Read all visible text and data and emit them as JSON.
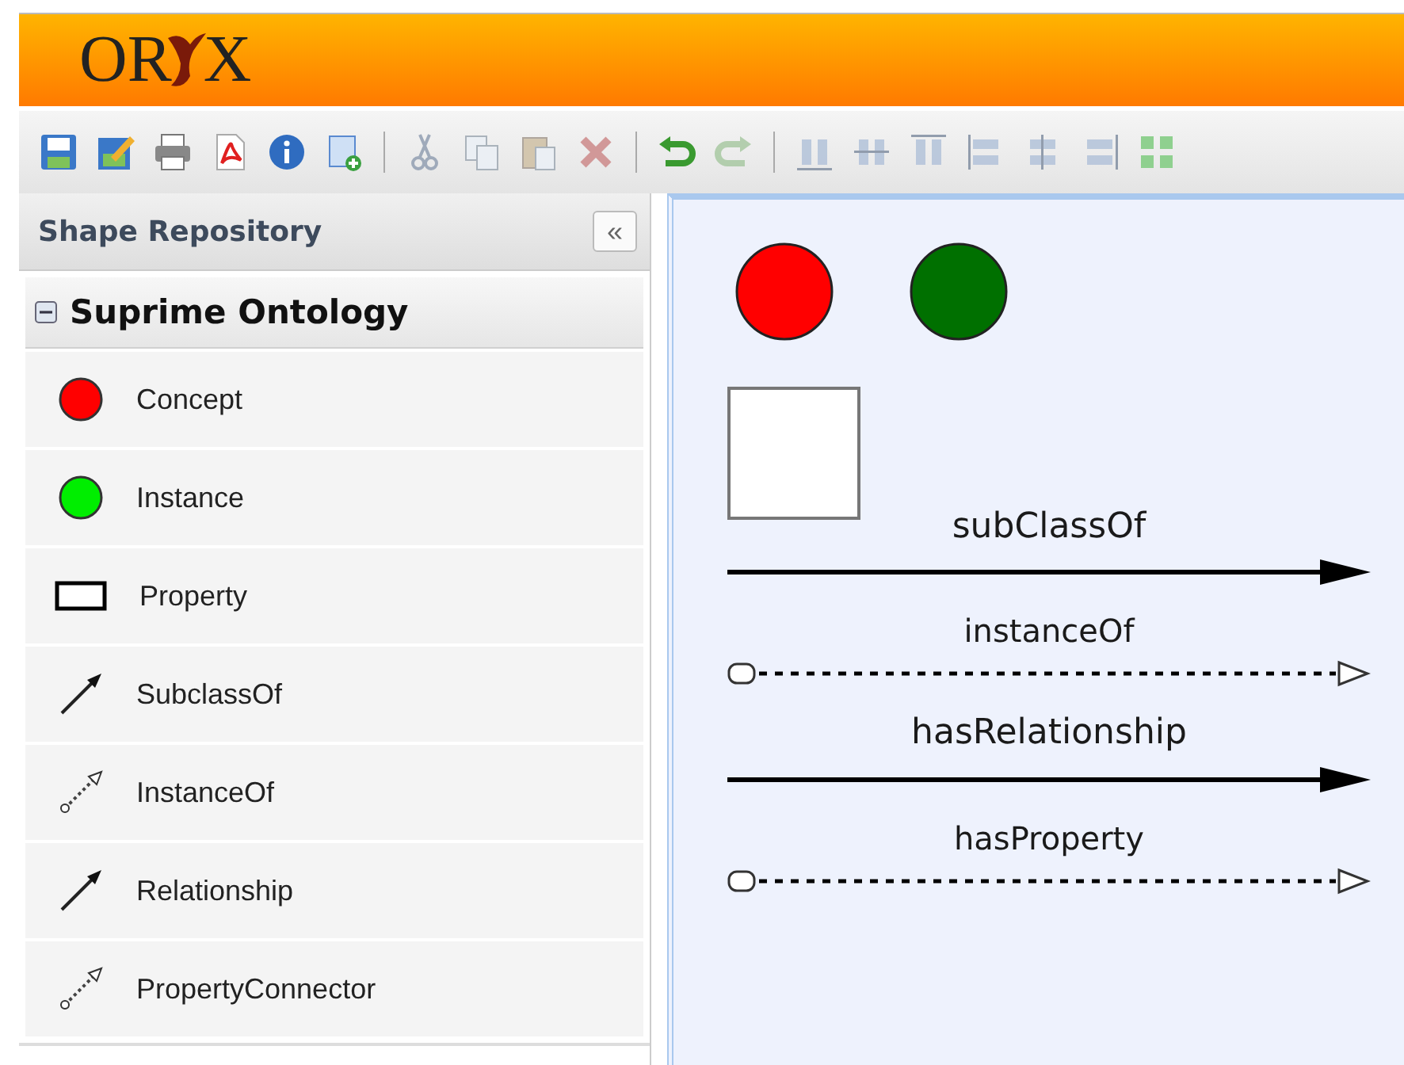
{
  "header": {
    "logo_left": "OR",
    "logo_right": "X"
  },
  "toolbar": [
    {
      "kind": "save",
      "disabled": false
    },
    {
      "kind": "edit",
      "disabled": false
    },
    {
      "kind": "print",
      "disabled": false
    },
    {
      "kind": "pdf",
      "disabled": false
    },
    {
      "kind": "info",
      "disabled": false
    },
    {
      "kind": "new",
      "disabled": false
    },
    {
      "kind": "sep"
    },
    {
      "kind": "cut",
      "disabled": true
    },
    {
      "kind": "copy",
      "disabled": true
    },
    {
      "kind": "paste",
      "disabled": true
    },
    {
      "kind": "delete",
      "disabled": true
    },
    {
      "kind": "sep"
    },
    {
      "kind": "undo",
      "disabled": false
    },
    {
      "kind": "redo",
      "disabled": true
    },
    {
      "kind": "sep"
    },
    {
      "kind": "align-bottom",
      "disabled": true
    },
    {
      "kind": "align-middle",
      "disabled": true
    },
    {
      "kind": "align-top",
      "disabled": true
    },
    {
      "kind": "align-left",
      "disabled": true
    },
    {
      "kind": "align-center",
      "disabled": true
    },
    {
      "kind": "align-right",
      "disabled": true
    },
    {
      "kind": "group",
      "disabled": false
    }
  ],
  "sidebar": {
    "title": "Shape Repository",
    "collapse_button": "«",
    "group": {
      "label": "Suprime Ontology",
      "expanded": true,
      "items": [
        {
          "label": "Concept",
          "kind": "circle",
          "color": "#ff0000"
        },
        {
          "label": "Instance",
          "kind": "circle",
          "color": "#00ee00"
        },
        {
          "label": "Property",
          "kind": "rect"
        },
        {
          "label": "SubclassOf",
          "kind": "arrow"
        },
        {
          "label": "InstanceOf",
          "kind": "dotted"
        },
        {
          "label": "Relationship",
          "kind": "arrow"
        },
        {
          "label": "PropertyConnector",
          "kind": "dotted"
        }
      ]
    }
  },
  "canvas": {
    "nodes": [
      {
        "kind": "circle",
        "color": "#ff0000"
      },
      {
        "kind": "circle",
        "color": "#007000"
      }
    ],
    "boxes": [
      {
        "kind": "rect"
      }
    ],
    "edges": [
      {
        "label": "subClassOf",
        "kind": "solid"
      },
      {
        "label": "instanceOf",
        "kind": "dotted"
      },
      {
        "label": "hasRelationship",
        "kind": "solid"
      },
      {
        "label": "hasProperty",
        "kind": "dotted"
      }
    ]
  }
}
